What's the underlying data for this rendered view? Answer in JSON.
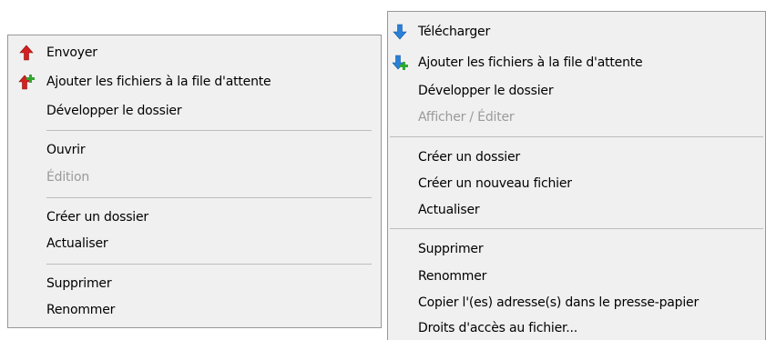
{
  "left_menu": {
    "items": [
      {
        "label": "Envoyer",
        "icon": "upload-arrow-icon"
      },
      {
        "label": "Ajouter les fichiers à la file d'attente",
        "icon": "queue-upload-icon"
      },
      {
        "label": "Développer le dossier"
      },
      {
        "label": "Ouvrir"
      },
      {
        "label": "Édition",
        "disabled": true
      },
      {
        "label": "Créer un dossier"
      },
      {
        "label": "Actualiser"
      },
      {
        "label": "Supprimer"
      },
      {
        "label": "Renommer"
      }
    ]
  },
  "right_menu": {
    "items": [
      {
        "label": "Télécharger",
        "icon": "download-arrow-icon"
      },
      {
        "label": "Ajouter les fichiers à la file d'attente",
        "icon": "queue-download-icon"
      },
      {
        "label": "Développer le dossier"
      },
      {
        "label": "Afficher / Éditer",
        "disabled": true
      },
      {
        "label": "Créer un dossier"
      },
      {
        "label": "Créer un nouveau fichier"
      },
      {
        "label": "Actualiser"
      },
      {
        "label": "Supprimer"
      },
      {
        "label": "Renommer"
      },
      {
        "label": "Copier l'(es) adresse(s) dans le presse-papier"
      },
      {
        "label": "Droits d'accès au fichier..."
      }
    ]
  },
  "colors": {
    "menu_background": "#f0f0f0",
    "border": "#979797",
    "disabled_text": "#9a9a9a",
    "upload_arrow": "#d42020",
    "download_arrow": "#2a7fd8",
    "queue_plus": "#2fa82f"
  }
}
